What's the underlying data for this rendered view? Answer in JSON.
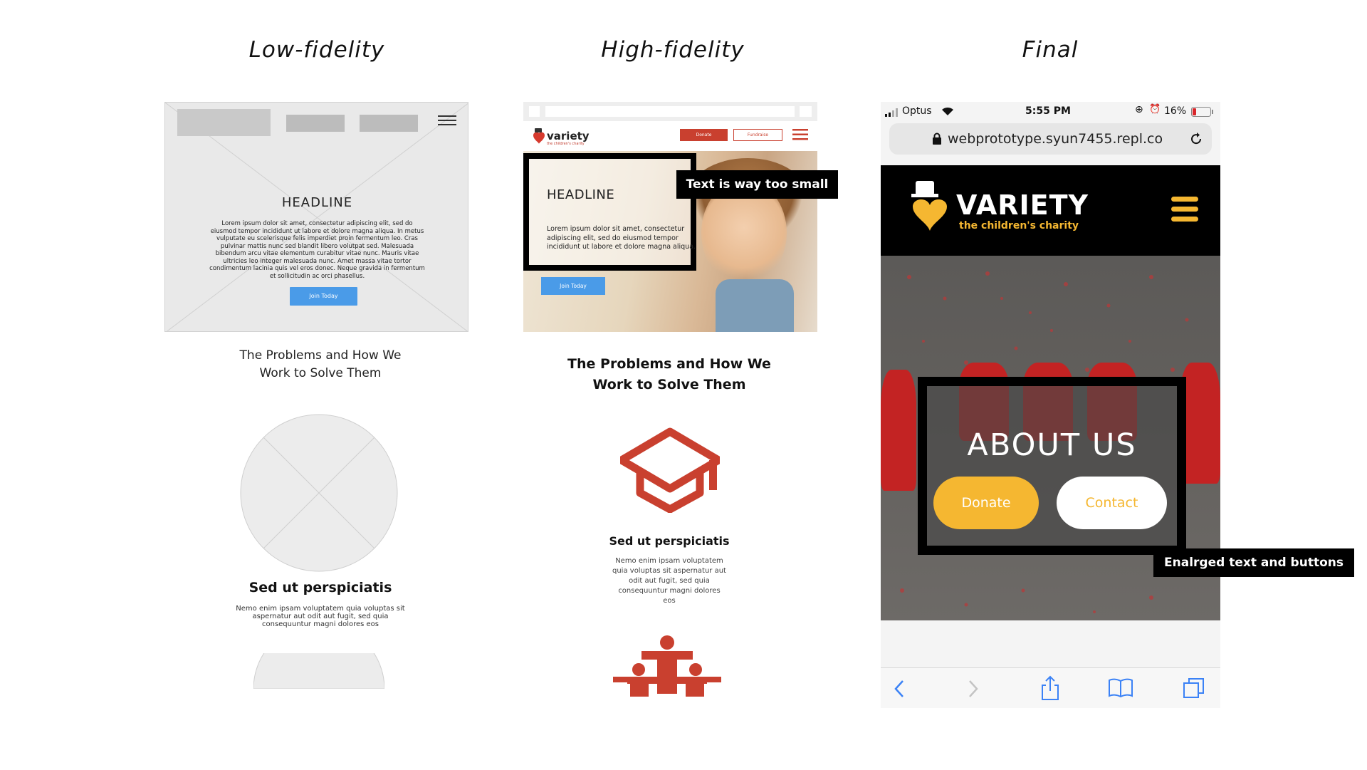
{
  "columns": {
    "low": "Low-fidelity",
    "high": "High-fidelity",
    "final": "Final"
  },
  "low_fidelity": {
    "headline": "HEADLINE",
    "body": "Lorem ipsum dolor sit amet, consectetur adipiscing elit, sed do eiusmod tempor incididunt ut labore et dolore magna aliqua. In metus vulputate eu scelerisque felis imperdiet proin fermentum leo. Cras pulvinar mattis nunc sed blandit libero volutpat sed. Malesuada bibendum arcu vitae elementum curabitur vitae nunc. Mauris vitae ultricies leo integer malesuada nunc. Amet massa vitae tortor condimentum lacinia quis vel eros donec. Neque gravida in fermentum et sollicitudin ac orci phasellus.",
    "cta": "Join Today",
    "section_title_1": "The Problems and How We",
    "section_title_2": "Work to Solve Them",
    "card_title": "Sed ut perspiciatis",
    "card_body": "Nemo enim ipsam voluptatem quia voluptas sit aspernatur aut odit aut fugit, sed quia consequuntur magni dolores eos"
  },
  "high_fidelity": {
    "logo": "variety",
    "logo_sub": "the children's charity",
    "donate": "Donate",
    "fundraise": "Fundraise",
    "headline": "HEADLINE",
    "body": "Lorem ipsum dolor sit amet, consectetur adipiscing elit, sed do eiusmod tempor incididunt ut labore et dolore magna aliqua.",
    "cta": "Join Today",
    "callout": "Text is way too small",
    "section_title_1": "The Problems and How We",
    "section_title_2": "Work to Solve Them",
    "card_title": "Sed ut perspiciatis",
    "card_body": "Nemo enim ipsam voluptatem quia voluptas sit aspernatur aut odit aut fugit, sed quia consequuntur magni dolores eos",
    "accent": "#c9402f"
  },
  "final": {
    "carrier": "Optus",
    "time": "5:55 PM",
    "battery": "16%",
    "url": "webprototype.syun7455.repl.co",
    "brand": "VARIETY",
    "tagline": "the children's charity",
    "about": "ABOUT US",
    "donate": "Donate",
    "contact": "Contact",
    "callout": "Enalrged text and buttons",
    "accent": "#f5b731",
    "toolbar_icons": [
      "back-icon",
      "forward-icon",
      "share-icon",
      "bookmarks-icon",
      "tabs-icon"
    ]
  }
}
